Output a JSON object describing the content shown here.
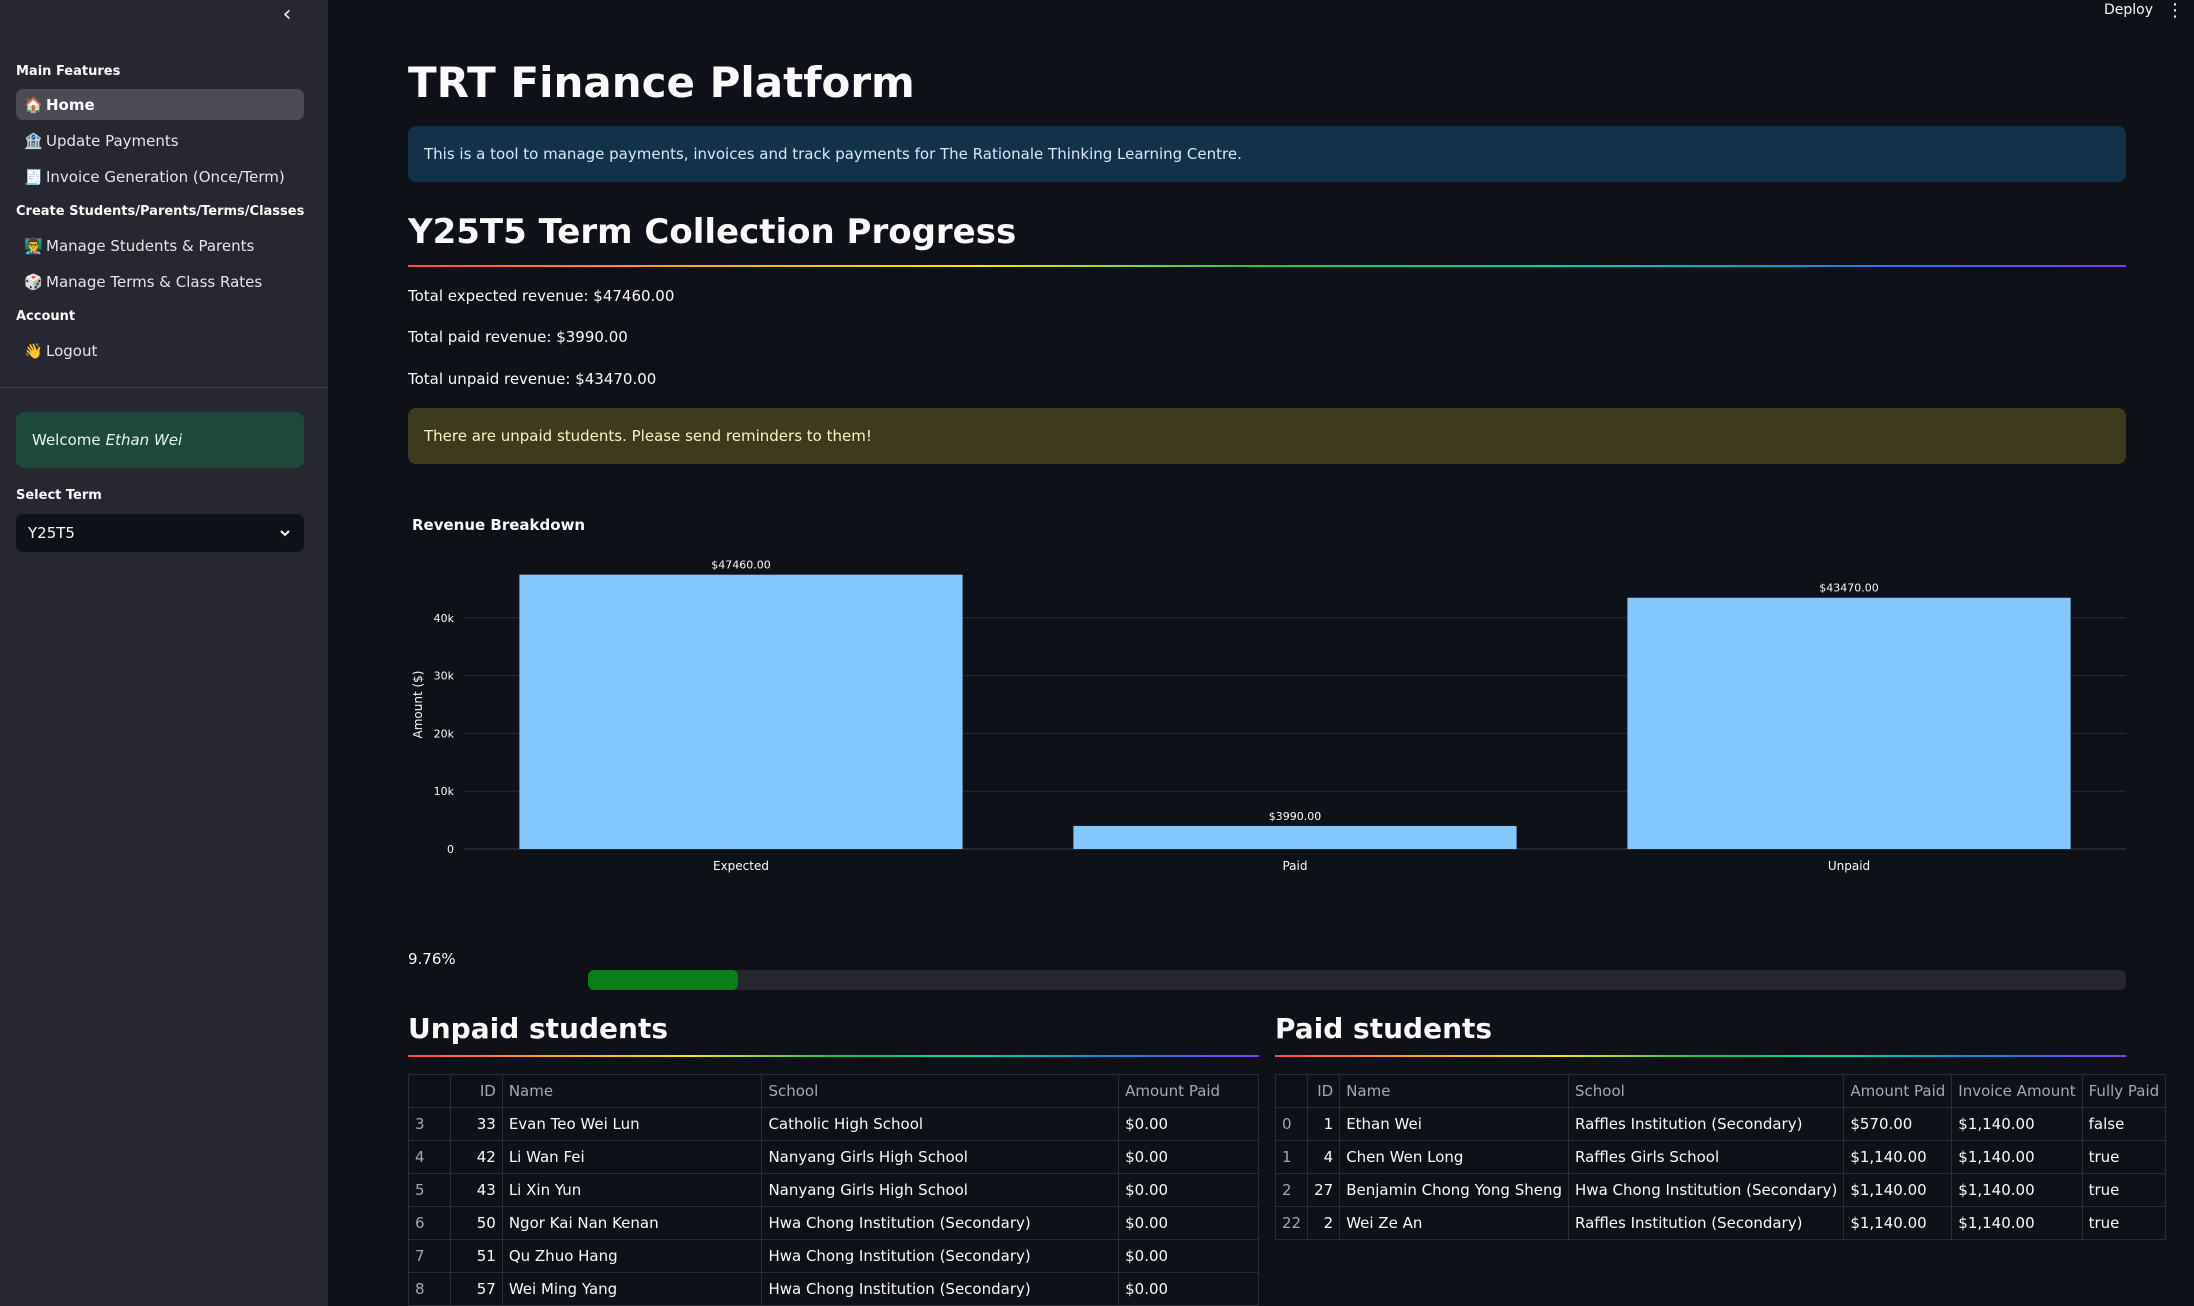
{
  "sidebar": {
    "collapse_icon": "chevron-left-icon",
    "sections": [
      {
        "label": "Main Features"
      },
      {
        "label": "Create Students/Parents/Terms/Classes"
      },
      {
        "label": "Account"
      }
    ],
    "items": [
      {
        "label": "Home",
        "icon": "🏠"
      },
      {
        "label": "Update Payments",
        "icon": "🏦"
      },
      {
        "label": "Invoice Generation (Once/Term)",
        "icon": "🧾"
      },
      {
        "label": "Manage Students & Parents",
        "icon": "👨‍🏫"
      },
      {
        "label": "Manage Terms & Class Rates",
        "icon": "🎲"
      },
      {
        "label": "Logout",
        "icon": "👋"
      }
    ],
    "welcome_prefix": "Welcome",
    "welcome_name": "Ethan Wei",
    "select_label": "Select Term",
    "select_value": "Y25T5"
  },
  "header": {
    "deploy_label": "Deploy",
    "menu_icon": "⋮"
  },
  "main": {
    "title": "TRT Finance Platform",
    "info": "This is a tool to manage payments, invoices and track payments for The Rationale Thinking Learning Centre.",
    "progress_heading": "Y25T5 Term Collection Progress",
    "stats": {
      "expected": "Total expected revenue: $47460.00",
      "paid": "Total paid revenue: $3990.00",
      "unpaid": "Total unpaid revenue: $43470.00"
    },
    "warning": "There are unpaid students. Please send reminders to them!",
    "progress_label": "9.76%",
    "progress_value": 0.0976,
    "unpaid_heading": "Unpaid students",
    "paid_heading": "Paid students"
  },
  "chart_data": {
    "type": "bar",
    "title": "Revenue Breakdown",
    "xlabel": "",
    "ylabel": "Amount ($)",
    "categories": [
      "Expected",
      "Paid",
      "Unpaid"
    ],
    "values": [
      47460,
      3990,
      43470
    ],
    "data_labels": [
      "$47460.00",
      "$3990.00",
      "$43470.00"
    ],
    "yticks": [
      0,
      10000,
      20000,
      30000,
      40000
    ],
    "ytick_labels": [
      "0",
      "10k",
      "20k",
      "30k",
      "40k"
    ],
    "ylim": [
      0,
      50000
    ],
    "bar_color": "#83c9ff",
    "grid": true
  },
  "unpaid_table": {
    "columns": [
      "",
      "ID",
      "Name",
      "School",
      "Amount Paid"
    ],
    "rows": [
      [
        "3",
        "33",
        "Evan Teo Wei Lun",
        "Catholic High School",
        "$0.00"
      ],
      [
        "4",
        "42",
        "Li Wan Fei",
        "Nanyang Girls High School",
        "$0.00"
      ],
      [
        "5",
        "43",
        "Li Xin Yun",
        "Nanyang Girls High School",
        "$0.00"
      ],
      [
        "6",
        "50",
        "Ngor Kai Nan Kenan",
        "Hwa Chong Institution (Secondary)",
        "$0.00"
      ],
      [
        "7",
        "51",
        "Qu Zhuo Hang",
        "Hwa Chong Institution (Secondary)",
        "$0.00"
      ],
      [
        "8",
        "57",
        "Wei Ming Yang",
        "Hwa Chong Institution (Secondary)",
        "$0.00"
      ]
    ]
  },
  "paid_table": {
    "columns": [
      "",
      "ID",
      "Name",
      "School",
      "Amount Paid",
      "Invoice Amount",
      "Fully Paid"
    ],
    "rows": [
      [
        "0",
        "1",
        "Ethan Wei",
        "Raffles Institution (Secondary)",
        "$570.00",
        "$1,140.00",
        "false"
      ],
      [
        "1",
        "4",
        "Chen Wen Long",
        "Raffles Girls School",
        "$1,140.00",
        "$1,140.00",
        "true"
      ],
      [
        "2",
        "27",
        "Benjamin Chong Yong Sheng",
        "Hwa Chong Institution (Secondary)",
        "$1,140.00",
        "$1,140.00",
        "true"
      ],
      [
        "22",
        "2",
        "Wei Ze An",
        "Raffles Institution (Secondary)",
        "$1,140.00",
        "$1,140.00",
        "true"
      ]
    ]
  }
}
